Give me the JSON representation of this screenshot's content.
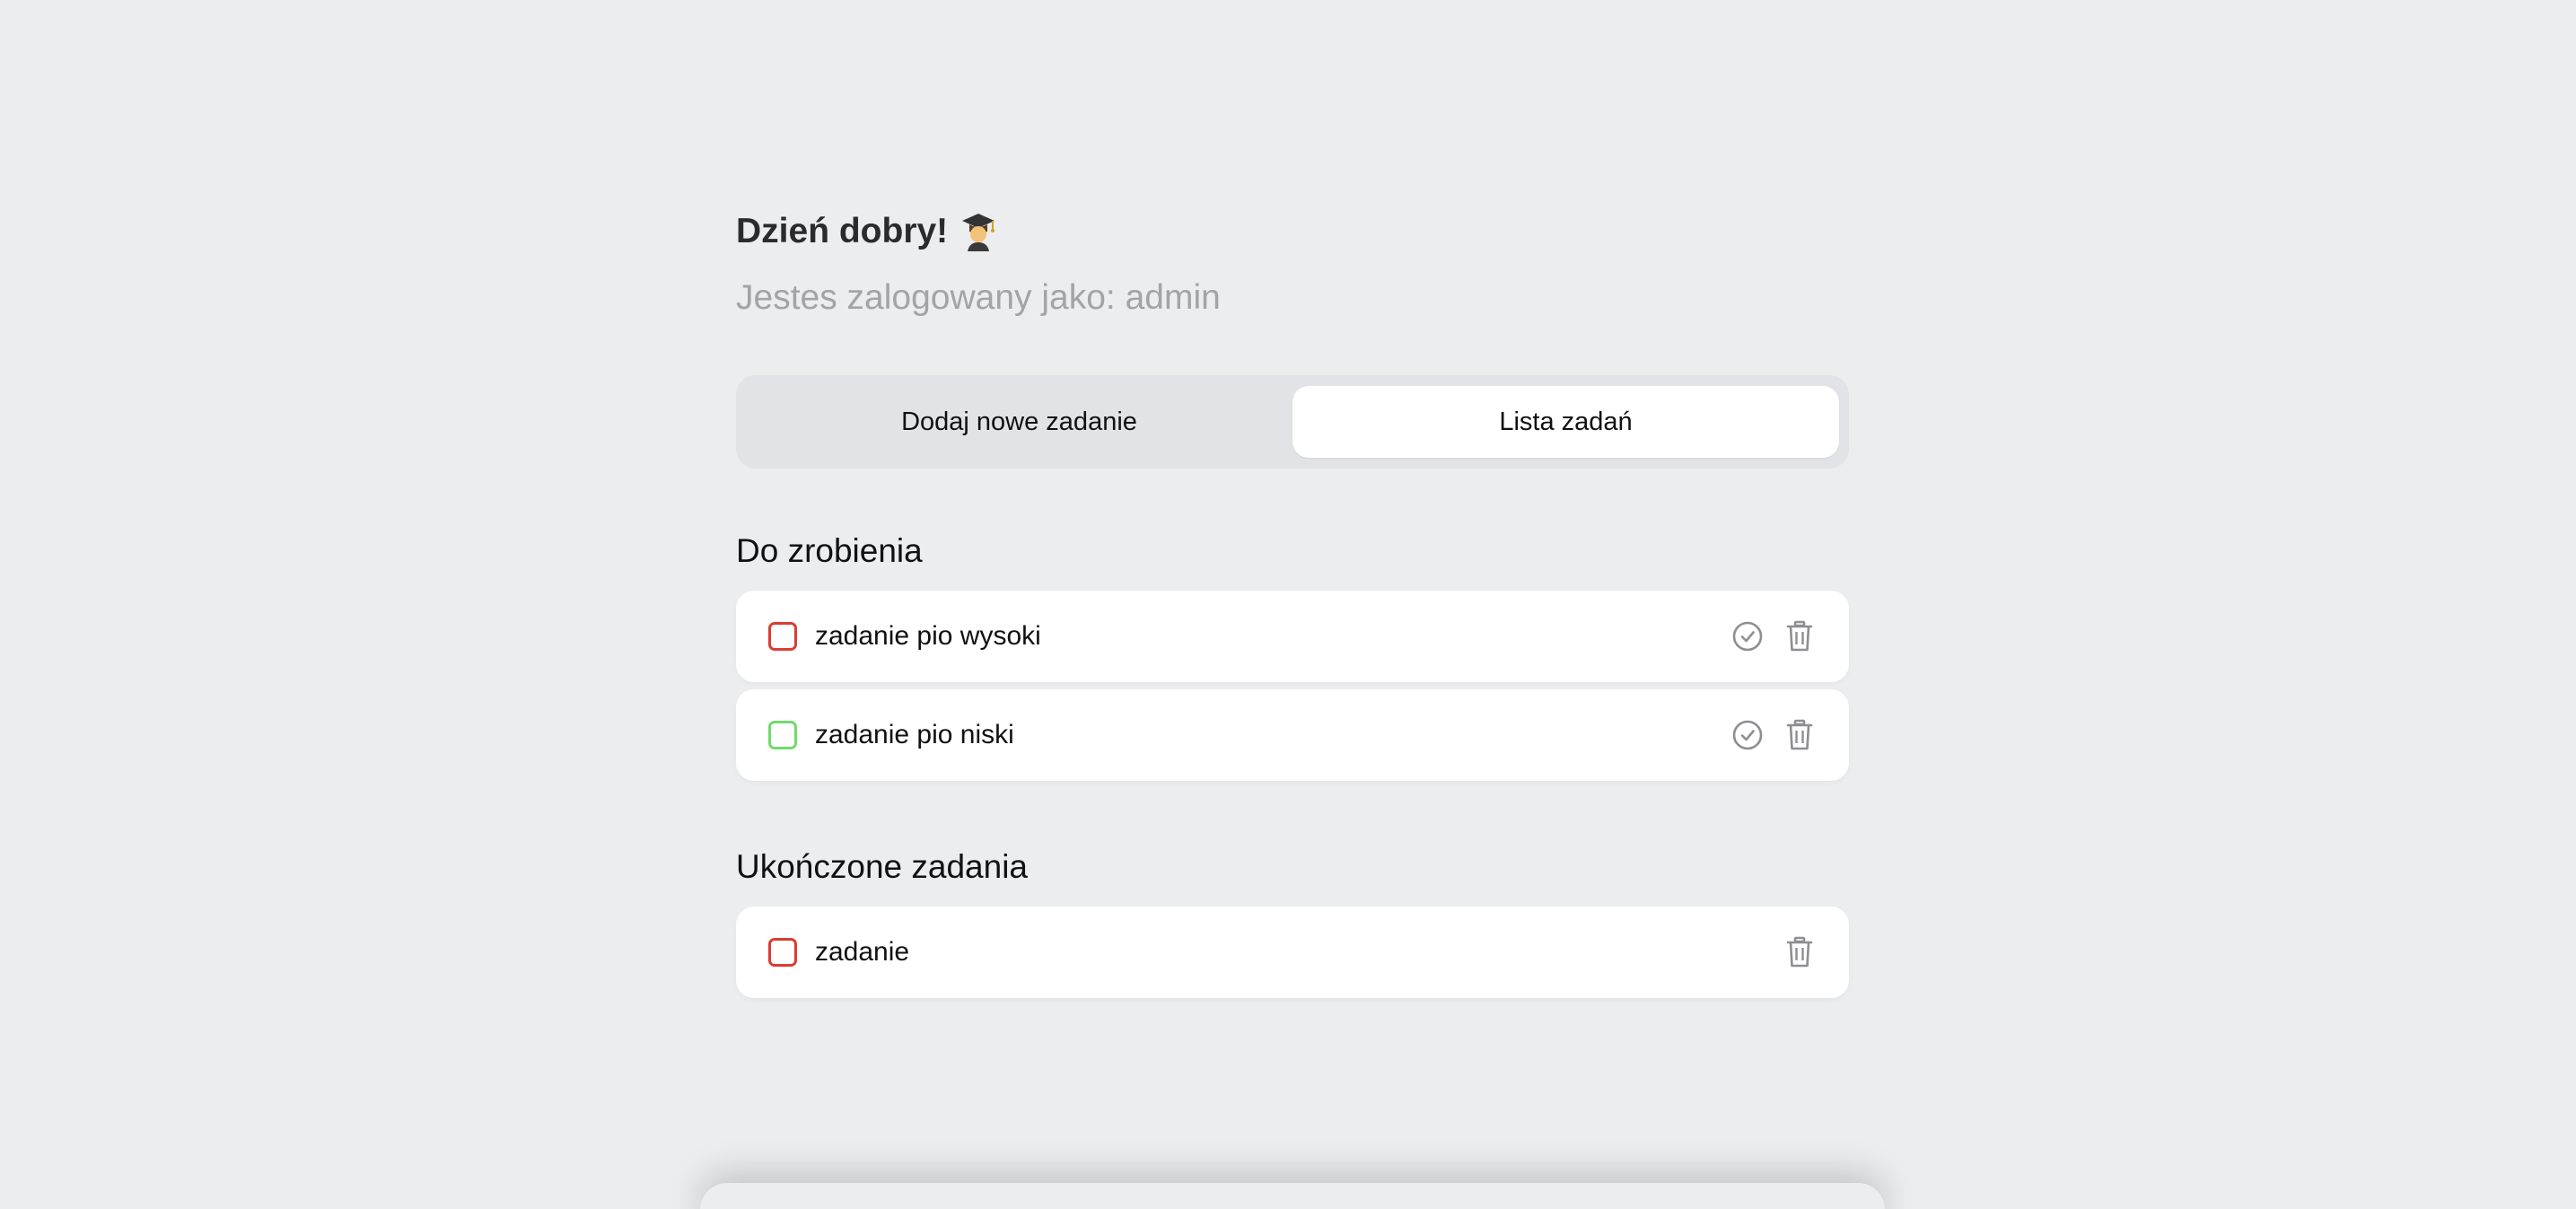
{
  "header": {
    "greeting": "Dzień dobry!",
    "greeting_icon": "student-emoji-icon",
    "subtitle": "Jestes zalogowany jako: admin"
  },
  "tabs": [
    {
      "label": "Dodaj nowe zadanie",
      "active": false
    },
    {
      "label": "Lista zadań",
      "active": true
    }
  ],
  "todo": {
    "title": "Do zrobienia",
    "tasks": [
      {
        "label": "zadanie pio wysoki",
        "priority_color": "#dc3c32",
        "actions": [
          "check-circle-icon",
          "trash-icon"
        ]
      },
      {
        "label": "zadanie pio niski",
        "priority_color": "#6fdc6a",
        "actions": [
          "check-circle-icon",
          "trash-icon"
        ]
      }
    ]
  },
  "done": {
    "title": "Ukończone zadania",
    "tasks": [
      {
        "label": "zadanie",
        "priority_color": "#dc3c32",
        "actions": [
          "trash-icon"
        ]
      }
    ]
  },
  "colors": {
    "background": "#ecedef",
    "card": "#ffffff",
    "muted_text": "#a3a3a8",
    "icon": "#8e8e93"
  }
}
